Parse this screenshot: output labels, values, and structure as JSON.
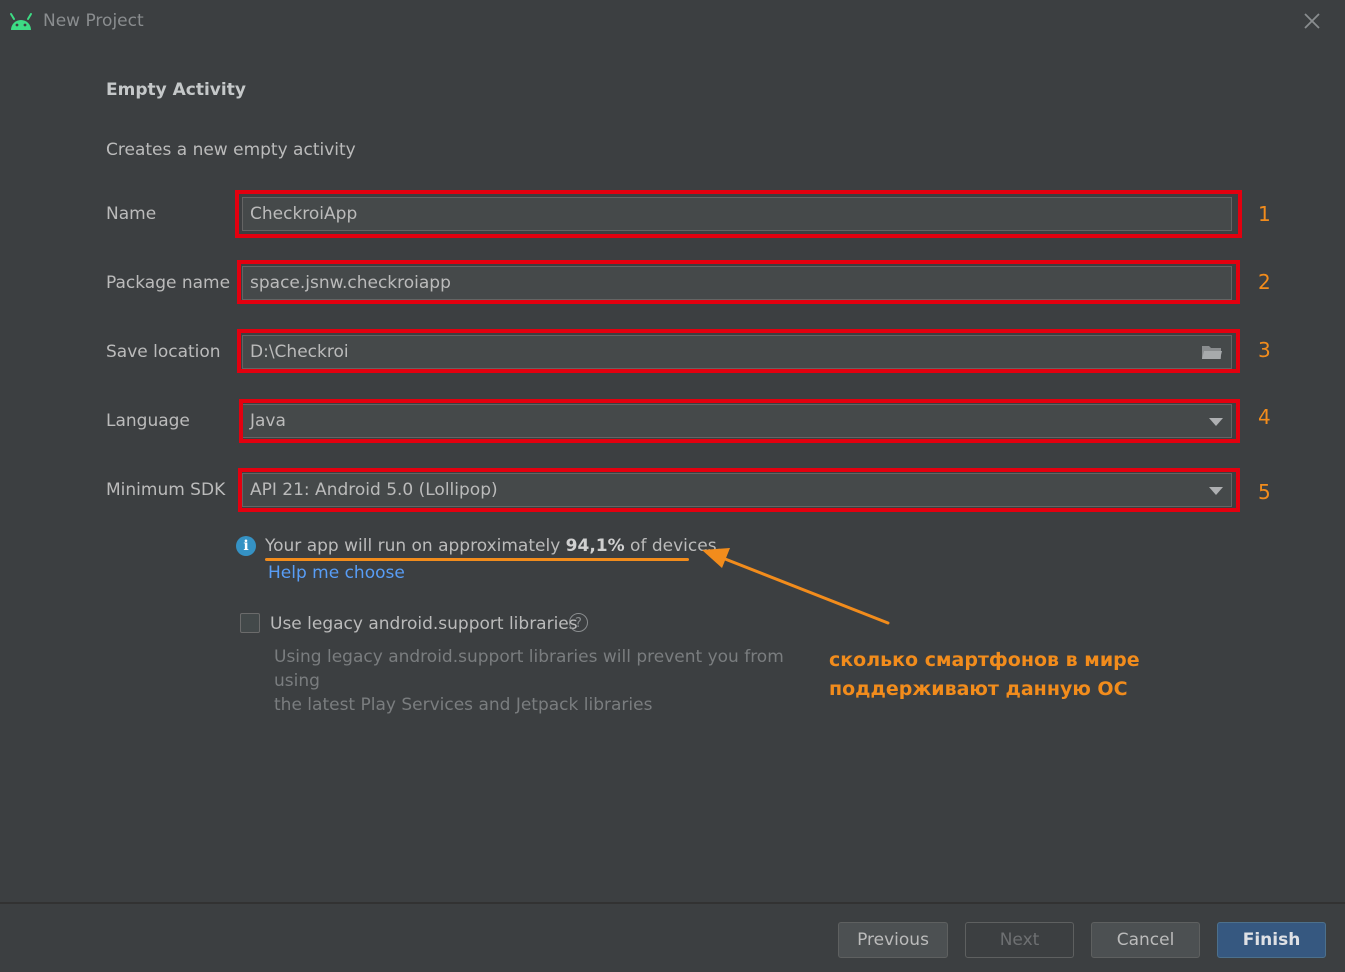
{
  "window": {
    "title": "New Project",
    "close_icon": "close-icon",
    "app_icon": "android-icon"
  },
  "header": {
    "title": "Empty Activity",
    "description": "Creates a new empty activity"
  },
  "form": {
    "name": {
      "label": "Name",
      "value": "CheckroiApp",
      "marker": "1"
    },
    "package": {
      "label": "Package name",
      "value": "space.jsnw.checkroiapp",
      "marker": "2"
    },
    "save_location": {
      "label": "Save location",
      "value": "D:\\Checkroi",
      "marker": "3",
      "icon": "folder-icon"
    },
    "language": {
      "label": "Language",
      "value": "Java",
      "marker": "4"
    },
    "min_sdk": {
      "label": "Minimum SDK",
      "value": "API 21: Android 5.0 (Lollipop)",
      "marker": "5"
    }
  },
  "info": {
    "prefix": "Your app will run on approximately ",
    "percent": "94,1%",
    "suffix": " of devices.",
    "help_link": "Help me choose"
  },
  "legacy": {
    "label": "Use legacy android.support libraries",
    "checked": false,
    "description_line1": "Using legacy android.support libraries will prevent you from using",
    "description_line2": "the latest Play Services and Jetpack libraries"
  },
  "annotation": {
    "line1": "сколько смартфонов в мире",
    "line2": "поддерживают данную ОС",
    "color": "#f28c1c"
  },
  "buttons": {
    "previous": "Previous",
    "next": "Next",
    "cancel": "Cancel",
    "finish": "Finish"
  },
  "colors": {
    "background": "#3c3f41",
    "highlight_red": "#e3000f",
    "accent_orange": "#f28c1c",
    "link_blue": "#589df6",
    "primary_button": "#365880"
  }
}
